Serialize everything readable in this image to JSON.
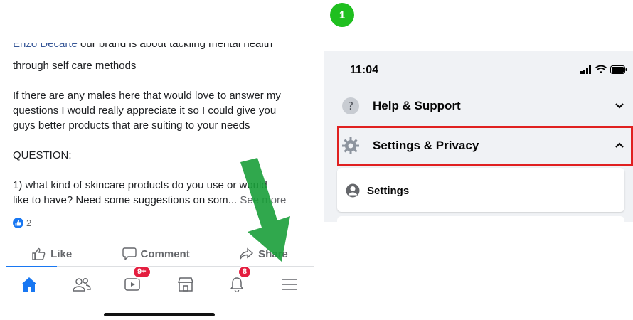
{
  "left_post": {
    "cut_line_author": "Enzo Decarte",
    "cut_line_text": " our brand is about tackling mental health",
    "line2": "through self care methods",
    "para2": [
      "If there are any males here that would love to answer my",
      "questions I would really appreciate it so I could give you",
      "guys better products that are suiting  to your needs"
    ],
    "question_heading": "QUESTION:",
    "question": [
      "1) what kind of skincare products do you use or would",
      "like to have? Need some suggestions on som..."
    ],
    "see_more": "See more",
    "reaction_count": "2",
    "like_label": "Like",
    "comment_label": "Comment",
    "share_label": "Share"
  },
  "tabbar": {
    "video_badge": "9+",
    "notif_badge": "8"
  },
  "step": {
    "number": "1"
  },
  "menu": {
    "time": "11:04",
    "help_label": "Help & Support",
    "settings_privacy_label": "Settings & Privacy",
    "settings_label": "Settings"
  },
  "colors": {
    "fb_blue": "#1877f2",
    "highlight_red": "#e02020",
    "step_green": "#1fbf1f",
    "arrow_green": "#1a9e3a"
  }
}
